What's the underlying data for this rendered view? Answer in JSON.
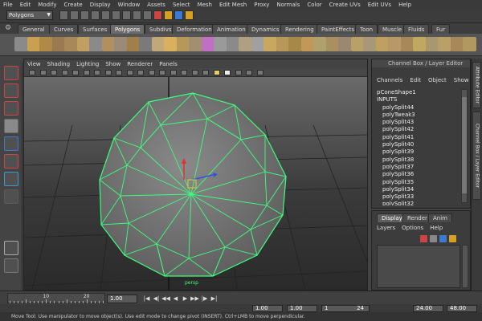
{
  "menubar": [
    "File",
    "Edit",
    "Modify",
    "Create",
    "Display",
    "Window",
    "Assets",
    "Select",
    "Mesh",
    "Edit Mesh",
    "Proxy",
    "Normals",
    "Color",
    "Create UVs",
    "Edit UVs",
    "Help"
  ],
  "status_line": {
    "mode": "Polygons",
    "icons": [
      "new-scene-icon",
      "open-scene-icon",
      "save-scene-icon",
      "select-by-hierarchy-icon",
      "select-by-object-icon",
      "select-by-component-icon",
      "snap-to-grid-icon",
      "snap-to-curve-icon",
      "snap-to-point-icon",
      "history-icon",
      "render-icon",
      "ipr-render-icon",
      "render-settings-icon"
    ]
  },
  "shelf_tabs": [
    "General",
    "Curves",
    "Surfaces",
    "Polygons",
    "Subdivs",
    "Deformation",
    "Animation",
    "Dynamics",
    "Rendering",
    "PaintEffects",
    "Toon",
    "Muscle",
    "Fluids",
    "Fur"
  ],
  "shelf_active_tab": "Polygons",
  "shelf_icons": [
    "poly-sphere-icon",
    "poly-cube-icon",
    "poly-cylinder-icon",
    "poly-cone-icon",
    "poly-plane-icon",
    "poly-torus-icon",
    "poly-prism-icon",
    "poly-pyramid-icon",
    "poly-pipe-icon",
    "poly-helix-icon",
    "poly-soccer-ball-icon",
    "poly-platonic-icon",
    "combine-icon",
    "separate-icon",
    "extract-icon",
    "booleans-icon",
    "smooth-icon",
    "average-icon",
    "mirror-icon",
    "sculpt-icon",
    "extrude-icon",
    "bridge-icon",
    "bevel-icon",
    "split-icon",
    "insert-loop-icon",
    "offset-loop-icon",
    "wedge-icon",
    "poke-icon",
    "duplicate-face-icon",
    "merge-icon",
    "collapse-icon",
    "delete-edge-icon",
    "uv-editor-icon",
    "planar-map-icon",
    "cylindrical-map-icon",
    "spherical-map-icon",
    "automatic-map-icon"
  ],
  "toolbox_icons": [
    "select-tool-icon",
    "lasso-tool-icon",
    "paint-select-tool-icon",
    "move-tool-icon",
    "rotate-tool-icon",
    "scale-tool-icon",
    "universal-manipulator-icon",
    "soft-mod-tool-icon",
    "show-manipulator-icon",
    "last-tool-icon"
  ],
  "viewport": {
    "menu": [
      "View",
      "Shading",
      "Lighting",
      "Show",
      "Renderer",
      "Panels"
    ],
    "camera_label": "persp"
  },
  "channel_box": {
    "title": "Channel Box / Layer Editor",
    "menu": [
      "Channels",
      "Edit",
      "Object",
      "Show"
    ],
    "object": "pConeShape1",
    "inputs_label": "INPUTS",
    "inputs": [
      "polySplit44",
      "polyTweak3",
      "polySplit43",
      "polySplit42",
      "polySplit41",
      "polySplit40",
      "polySplit39",
      "polySplit38",
      "polySplit37",
      "polySplit36",
      "polySplit35",
      "polySplit34",
      "polySplit33",
      "polySplit32"
    ]
  },
  "side_tabs": [
    "Attribute Editor",
    "Channel Box / Layer Editor"
  ],
  "layer_editor": {
    "tabs": [
      "Display",
      "Render",
      "Anim"
    ],
    "active_tab": "Display",
    "menu": [
      "Layers",
      "Options",
      "Help"
    ]
  },
  "time_slider": {
    "ticks": [
      {
        "value": 10,
        "label": "10"
      },
      {
        "value": 20,
        "label": "20"
      }
    ],
    "current_frame": "1.00",
    "playback_start": "1.00",
    "range_start": "1.00",
    "range_inner_start": "1",
    "range_inner_end": "24",
    "range_end": "24.00",
    "playback_end": "48.00"
  },
  "help_line": "Move Tool: Use manipulator to move object(s). Use edit mode to change pivot (INSERT).  Ctrl+LMB to move perpendicular."
}
